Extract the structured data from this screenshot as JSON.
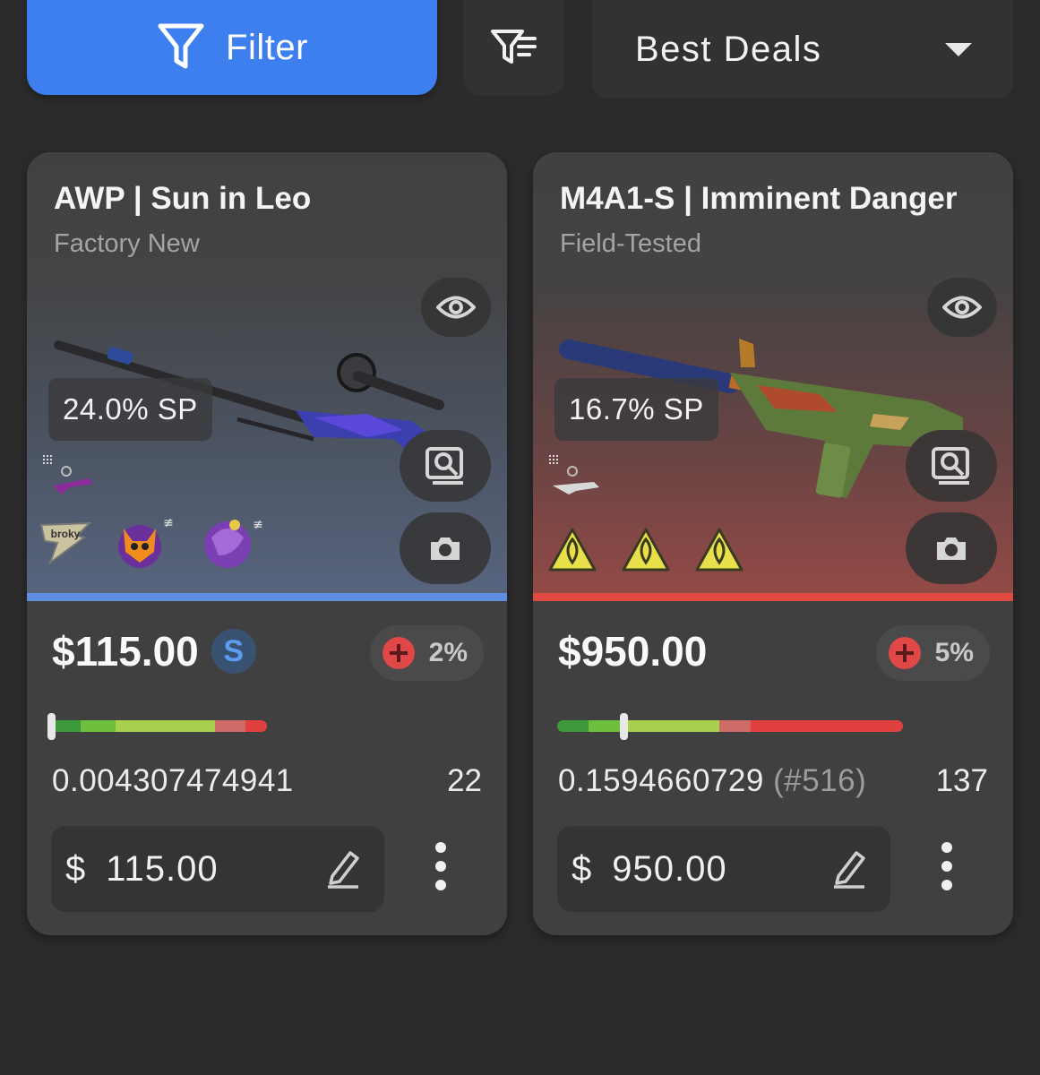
{
  "toolbar": {
    "filter_label": "Filter",
    "filter_icon": "funnel-icon",
    "sort_icon": "sort-lines-funnel-icon",
    "sort_value": "Best Deals",
    "accent": "#3d7fef"
  },
  "cards": [
    {
      "title": "AWP | Sun in Leo",
      "wear": "Factory New",
      "sp_badge": "24.0% SP",
      "price": "$115.00",
      "currency_badge": "S",
      "change_pct": "2%",
      "float_value": "0.004307474941",
      "float_rank": "",
      "float_fraction": 0.0043,
      "pattern_seed": "22",
      "input_currency": "$",
      "input_value": "115.00",
      "rarity_color": "#5f8ee0",
      "stickers": [
        "sticker-broky",
        "sticker-fox",
        "sticker-purple-creature"
      ]
    },
    {
      "title": "M4A1-S | Imminent Danger",
      "wear": "Field-Tested",
      "sp_badge": "16.7% SP",
      "price": "$950.00",
      "currency_badge": "",
      "change_pct": "5%",
      "float_value": "0.1594660729",
      "float_rank": "(#516)",
      "float_fraction": 0.1595,
      "pattern_seed": "137",
      "input_currency": "$",
      "input_value": "950.00",
      "rarity_color": "#e0493f",
      "stickers": [
        "sticker-danger-warning",
        "sticker-danger-warning",
        "sticker-danger-warning"
      ]
    }
  ]
}
